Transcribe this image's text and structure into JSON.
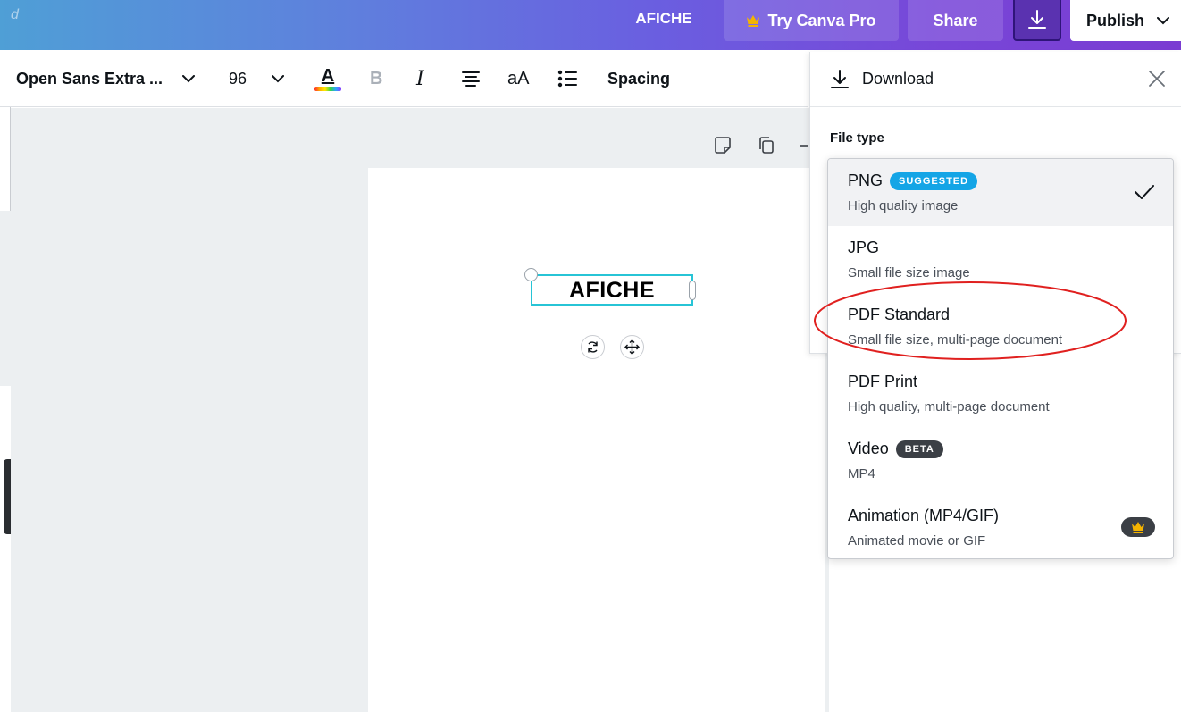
{
  "topbar": {
    "ghost_text": "d",
    "doc_title": "AFICHE",
    "try_pro_label": "Try Canva Pro",
    "share_label": "Share",
    "publish_label": "Publish"
  },
  "toolbar": {
    "font_name": "Open Sans Extra ...",
    "font_size": "96",
    "text_case_label": "aA",
    "bold_label": "B",
    "italic_label": "I",
    "color_letter": "A",
    "spacing_label": "Spacing"
  },
  "canvas": {
    "text_element": "AFICHE"
  },
  "download_panel": {
    "title": "Download",
    "file_type_label": "File type",
    "options": [
      {
        "name": "PNG",
        "badge": "SUGGESTED",
        "description": "High quality image",
        "selected": true
      },
      {
        "name": "JPG",
        "description": "Small file size image"
      },
      {
        "name": "PDF Standard",
        "description": "Small file size, multi-page document",
        "highlighted": true
      },
      {
        "name": "PDF Print",
        "description": "High quality, multi-page document"
      },
      {
        "name": "Video",
        "badge": "BETA",
        "description": "MP4"
      },
      {
        "name": "Animation (MP4/GIF)",
        "description": "Animated movie or GIF",
        "pro": true
      }
    ]
  },
  "colors": {
    "accent_purple": "#7a3cd2",
    "selection_cyan": "#27c4d6",
    "suggested_blue": "#14a5e6",
    "annotation_red": "#e0201f",
    "crown_gold": "#f5b400"
  }
}
